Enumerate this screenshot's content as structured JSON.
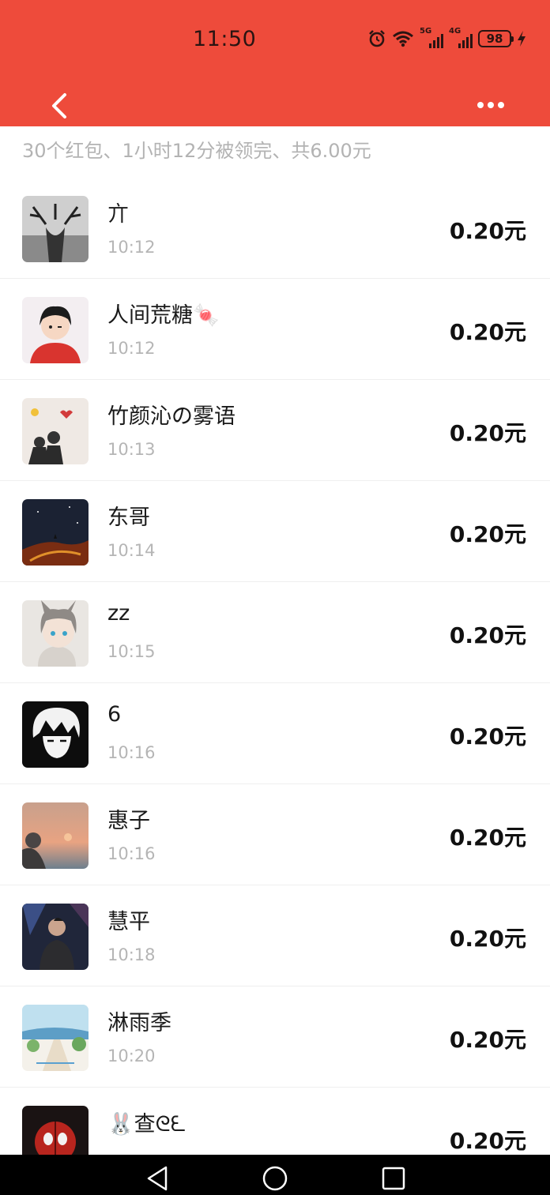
{
  "status_bar": {
    "time": "11:50",
    "signal_5g": "5G",
    "signal_4g": "4G",
    "battery": "98"
  },
  "header": {
    "back_icon": "chevron-left-icon",
    "more_icon": "more-horizontal-icon"
  },
  "summary": "30个红包、1小时12分被领完、共6.00元",
  "records": [
    {
      "name": "亣",
      "time": "10:12",
      "amount": "0.20元"
    },
    {
      "name": "人间荒糖🍬",
      "time": "10:12",
      "amount": "0.20元"
    },
    {
      "name": "竹颜沁の雾语",
      "time": "10:13",
      "amount": "0.20元"
    },
    {
      "name": "东哥",
      "time": "10:14",
      "amount": "0.20元"
    },
    {
      "name": "zz",
      "time": "10:15",
      "amount": "0.20元"
    },
    {
      "name": "6",
      "time": "10:16",
      "amount": "0.20元"
    },
    {
      "name": "惠子",
      "time": "10:16",
      "amount": "0.20元"
    },
    {
      "name": "慧平",
      "time": "10:18",
      "amount": "0.20元"
    },
    {
      "name": "淋雨季",
      "time": "10:20",
      "amount": "0.20元"
    },
    {
      "name": "🐰查ᘓᘍ",
      "time": "",
      "amount": "0.20元"
    }
  ],
  "colors": {
    "header_bg": "#ee4b3b",
    "summary_text": "#b3b3b3",
    "time_text": "#b5b5b5"
  }
}
